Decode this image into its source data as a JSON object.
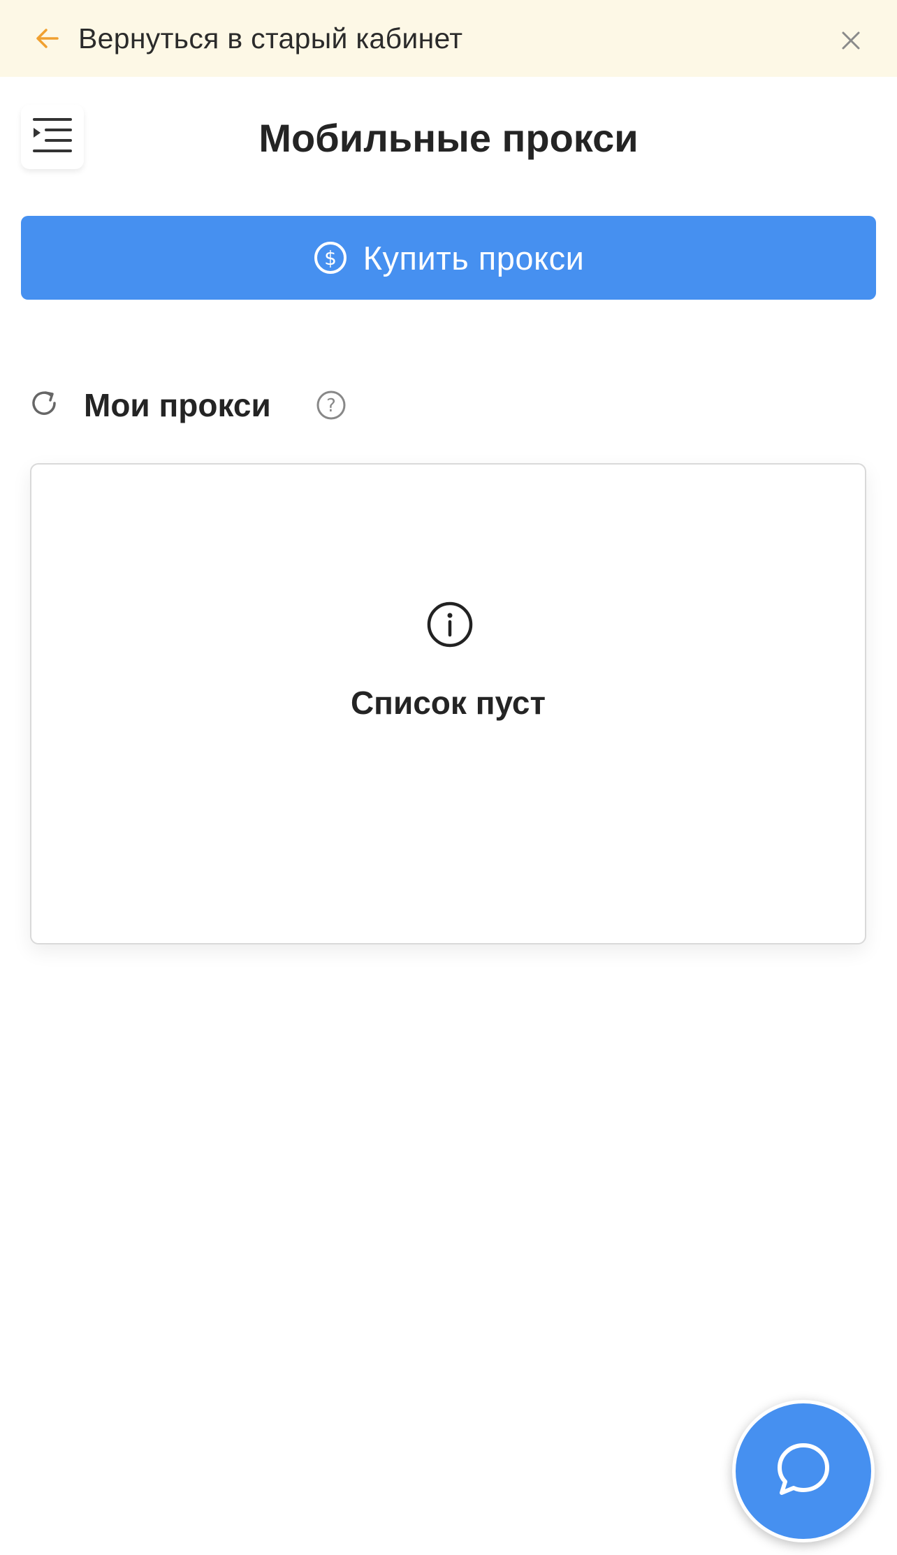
{
  "banner": {
    "text": "Вернуться в старый кабинет",
    "back_icon": "arrow-left-icon",
    "close_icon": "close-icon",
    "background_color": "#fdf8e6",
    "icon_accent_color": "#f0a030"
  },
  "header": {
    "title": "Мобильные прокси",
    "menu_icon": "menu-indent-icon"
  },
  "buy_button": {
    "label": "Купить прокси",
    "icon": "dollar-circle-icon",
    "color": "#4690f0"
  },
  "section": {
    "title": "Мои прокси",
    "refresh_icon": "refresh-icon",
    "help_icon": "question-circle-icon"
  },
  "empty_state": {
    "icon": "info-circle-icon",
    "text": "Список пуст"
  },
  "chat": {
    "icon": "chat-bubble-icon",
    "color": "#4690f0"
  }
}
